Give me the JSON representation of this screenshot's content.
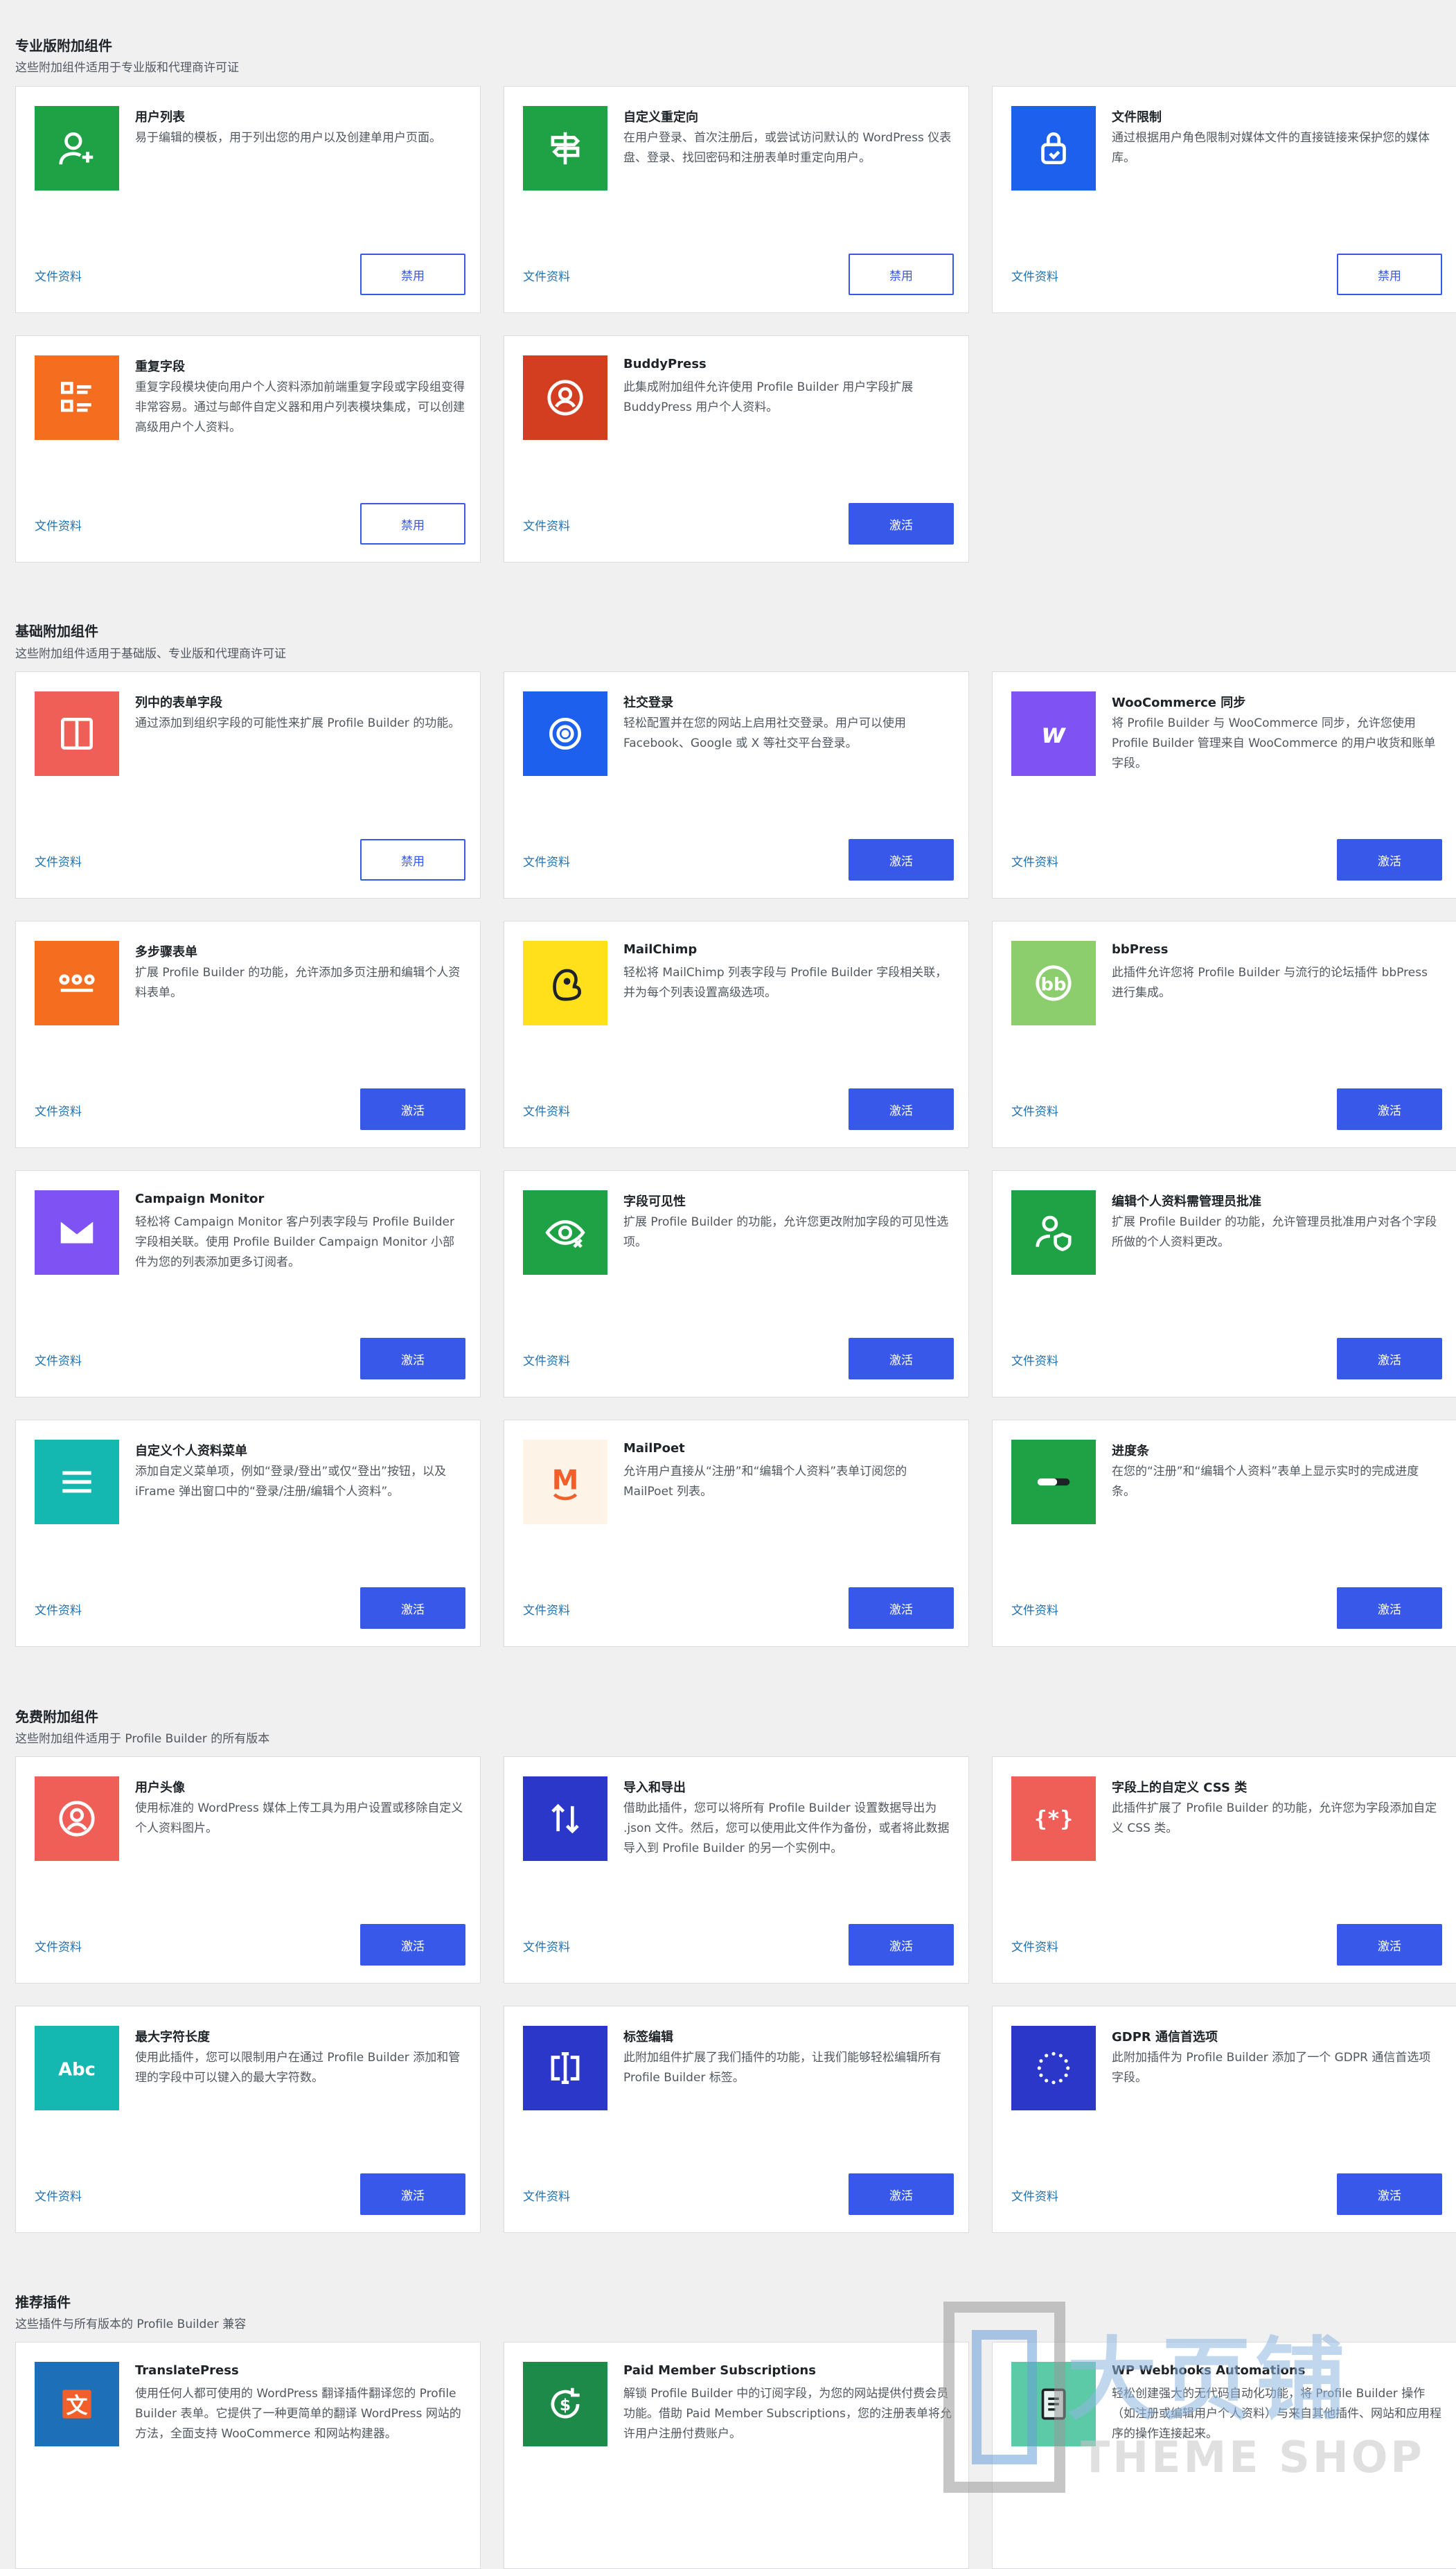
{
  "sections": {
    "pro": {
      "title": "专业版附加组件",
      "subtitle": "这些附加组件适用于专业版和代理商许可证"
    },
    "basic": {
      "title": "基础附加组件",
      "subtitle": "这些附加组件适用于基础版、专业版和代理商许可证"
    },
    "free": {
      "title": "免费附加组件",
      "subtitle": "这些附加组件适用于 Profile Builder 的所有版本"
    },
    "recommended": {
      "title": "推荐插件",
      "subtitle": "这些插件与所有版本的 Profile Builder 兼容"
    }
  },
  "doc_label": "文件资料",
  "labels": {
    "activate": "激活",
    "disable": "禁用"
  },
  "colors": {
    "accent": "#3858e9",
    "link": "#2271b1"
  },
  "cards": [
    {
      "title": "用户列表",
      "desc": "易于编辑的模板，用于列出您的用户以及创建单用户页面。",
      "icon": "add-user-icon",
      "color": "#1fa145",
      "button": "禁用"
    },
    {
      "title": "自定义重定向",
      "desc": "在用户登录、首次注册后，或尝试访问默认的 WordPress 仪表盘、登录、找回密码和注册表单时重定向用户。",
      "icon": "signpost-icon",
      "color": "#1fa145",
      "button": "禁用"
    },
    {
      "title": "文件限制",
      "desc": "通过根据用户角色限制对媒体文件的直接链接来保护您的媒体库。",
      "icon": "file-lock-icon",
      "color": "#1e60ee",
      "button": "禁用"
    },
    {
      "title": "重复字段",
      "desc": "重复字段模块使向用户个人资料添加前端重复字段或字段组变得非常容易。通过与邮件自定义器和用户列表模块集成，可以创建高级用户个人资料。",
      "icon": "list-icon",
      "color": "#f56d1e",
      "button": "禁用"
    },
    {
      "title": "BuddyPress",
      "desc": "此集成附加组件允许使用 Profile Builder 用户字段扩展 BuddyPress 用户个人资料。",
      "icon": "buddypress-icon",
      "color": "#d43e20",
      "button": "激活"
    },
    {
      "title": "列中的表单字段",
      "desc": "通过添加到组织字段的可能性来扩展 Profile Builder 的功能。",
      "icon": "columns-icon",
      "color": "#ef5f58",
      "button": "禁用"
    },
    {
      "title": "社交登录",
      "desc": "轻松配置并在您的网站上启用社交登录。用户可以使用 Facebook、Google 或 X 等社交平台登录。",
      "icon": "social-login-icon",
      "color": "#1e60ee",
      "button": "激活"
    },
    {
      "title": "WooCommerce 同步",
      "desc": "将 Profile Builder 与 WooCommerce 同步，允许您使用 Profile Builder 管理来自 WooCommerce 的用户收货和账单字段。",
      "icon": "woocommerce-icon",
      "color": "#7f53f3",
      "button": "激活"
    },
    {
      "title": "多步骤表单",
      "desc": "扩展 Profile Builder 的功能，允许添加多页注册和编辑个人资料表单。",
      "icon": "steps-icon",
      "color": "#f56d1e",
      "button": "激活"
    },
    {
      "title": "MailChimp",
      "desc": "轻松将 MailChimp 列表字段与 Profile Builder 字段相关联，并为每个列表设置高级选项。",
      "icon": "mailchimp-icon",
      "color": "#ffe01b",
      "button": "激活"
    },
    {
      "title": "bbPress",
      "desc": "此插件允许您将 Profile Builder 与流行的论坛插件 bbPress 进行集成。",
      "icon": "bbpress-icon",
      "color": "#8ccd6e",
      "button": "激活"
    },
    {
      "title": "Campaign Monitor",
      "desc": "轻松将 Campaign Monitor 客户列表字段与 Profile Builder 字段相关联。使用 Profile Builder Campaign Monitor 小部件为您的列表添加更多订阅者。",
      "icon": "campaign-monitor-icon",
      "color": "#7f53f3",
      "button": "激活"
    },
    {
      "title": "字段可见性",
      "desc": "扩展 Profile Builder 的功能，允许您更改附加字段的可见性选项。",
      "icon": "eye-off-icon",
      "color": "#1fa145",
      "button": "激活"
    },
    {
      "title": "编辑个人资料需管理员批准",
      "desc": "扩展 Profile Builder 的功能，允许管理员批准用户对各个字段所做的个人资料更改。",
      "icon": "user-shield-icon",
      "color": "#1fa145",
      "button": "激活"
    },
    {
      "title": "自定义个人资料菜单",
      "desc": "添加自定义菜单项，例如“登录/登出”或仅“登出”按钮，以及 iFrame 弹出窗口中的“登录/注册/编辑个人资料”。",
      "icon": "menu-icon",
      "color": "#14b8b0",
      "button": "激活"
    },
    {
      "title": "MailPoet",
      "desc": "允许用户直接从“注册”和“编辑个人资料”表单订阅您的 MailPoet 列表。",
      "icon": "mailpoet-icon",
      "color": "#fdf3e6",
      "button": "激活"
    },
    {
      "title": "进度条",
      "desc": "在您的“注册”和“编辑个人资料”表单上显示实时的完成进度条。",
      "icon": "progress-bar-icon",
      "color": "#1fa145",
      "button": "激活"
    },
    {
      "title": "用户头像",
      "desc": "使用标准的 WordPress 媒体上传工具为用户设置或移除自定义个人资料图片。",
      "icon": "user-avatar-icon",
      "color": "#ef5f58",
      "button": "激活"
    },
    {
      "title": "导入和导出",
      "desc": "借助此插件，您可以将所有 Profile Builder 设置数据导出为 .json 文件。然后，您可以使用此文件作为备份，或者将此数据导入到 Profile Builder 的另一个实例中。",
      "icon": "import-export-icon",
      "color": "#2a37c8",
      "button": "激活"
    },
    {
      "title": "字段上的自定义 CSS 类",
      "desc": "此插件扩展了 Profile Builder 的功能，允许您为字段添加自定义 CSS 类。",
      "icon": "css-class-icon",
      "color": "#ef5f58",
      "button": "激活"
    },
    {
      "title": "最大字符长度",
      "desc": "使用此插件，您可以限制用户在通过 Profile Builder 添加和管理的字段中可以键入的最大字符数。",
      "icon": "abc-icon",
      "color": "#14b8b0",
      "button": "激活"
    },
    {
      "title": "标签编辑",
      "desc": "此附加组件扩展了我们插件的功能，让我们能够轻松编辑所有 Profile Builder 标签。",
      "icon": "label-edit-icon",
      "color": "#2a37c8",
      "button": "激活"
    },
    {
      "title": "GDPR 通信首选项",
      "desc": "此附加插件为 Profile Builder 添加了一个 GDPR 通信首选项字段。",
      "icon": "gdpr-icon",
      "color": "#2a37c8",
      "button": "激活"
    },
    {
      "title": "TranslatePress",
      "desc": "使用任何人都可使用的 WordPress 翻译插件翻译您的 Profile Builder 表单。它提供了一种更简单的翻译 WordPress 网站的方法，全面支持 WooCommerce 和网站构建器。",
      "icon": "translatepress-icon",
      "color": "#1d6fb8",
      "button": ""
    },
    {
      "title": "Paid Member Subscriptions",
      "desc": "解锁 Profile Builder 中的订阅字段，为您的网站提供付费会员功能。借助 Paid Member Subscriptions，您的注册表单将允许用户注册付费账户。",
      "icon": "pms-icon",
      "color": "#1e8a4a",
      "button": ""
    },
    {
      "title": "WP Webhooks Automations",
      "desc": "轻松创建强大的无代码自动化功能，将 Profile Builder 操作（如注册或编辑用户个人资料）与来自其他插件、网站和应用程序的操作连接起来。",
      "icon": "webhooks-icon",
      "color": "#5cc9a7",
      "button": ""
    }
  ],
  "watermark": {
    "cn": "大页铺",
    "en": "THEME SHOP"
  }
}
